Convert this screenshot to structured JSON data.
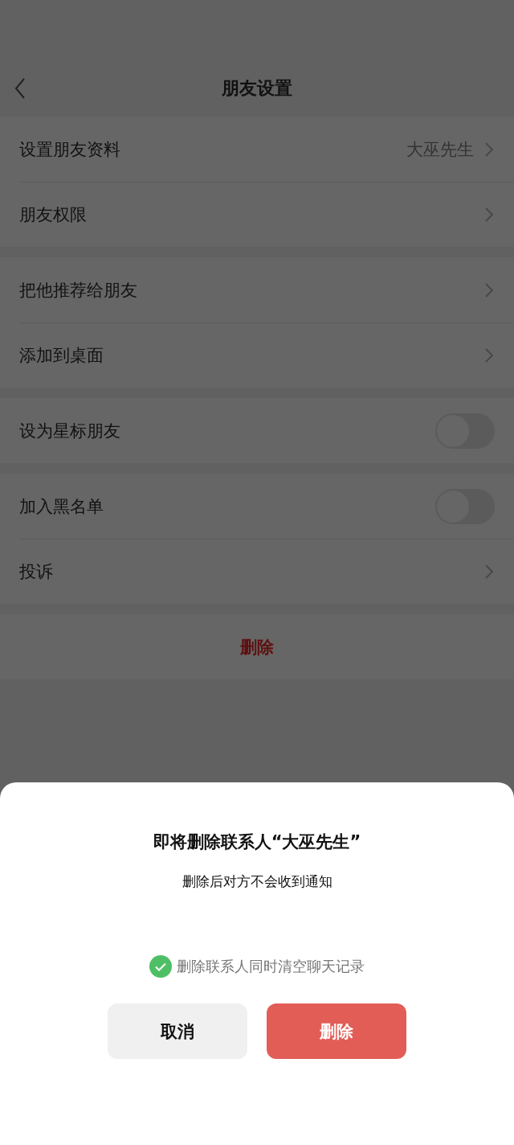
{
  "header": {
    "title": "朋友设置"
  },
  "groups": [
    {
      "rows": [
        {
          "kind": "link",
          "label": "设置朋友资料",
          "value": "大巫先生"
        },
        {
          "kind": "link",
          "label": "朋友权限"
        }
      ]
    },
    {
      "rows": [
        {
          "kind": "link",
          "label": "把他推荐给朋友"
        },
        {
          "kind": "link",
          "label": "添加到桌面"
        }
      ]
    },
    {
      "rows": [
        {
          "kind": "toggle",
          "label": "设为星标朋友",
          "on": false
        }
      ]
    },
    {
      "rows": [
        {
          "kind": "toggle",
          "label": "加入黑名单",
          "on": false
        },
        {
          "kind": "link",
          "label": "投诉"
        }
      ]
    }
  ],
  "delete_button": "删除",
  "dialog": {
    "title": "即将删除联系人“大巫先生”",
    "message": "删除后对方不会收到通知",
    "option": {
      "label": "删除联系人同时清空聊天记录",
      "checked": true
    },
    "buttons": [
      {
        "kind": "cancel",
        "label": "取消"
      },
      {
        "kind": "danger",
        "label": "删除"
      }
    ]
  }
}
